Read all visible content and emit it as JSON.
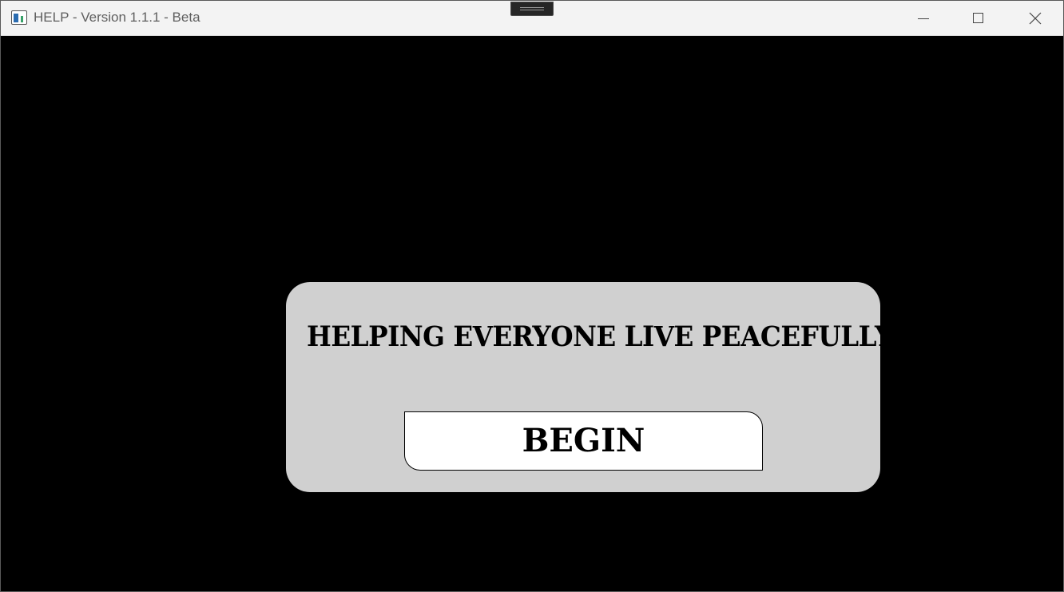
{
  "window": {
    "title": "HELP - Version 1.1.1 - Beta",
    "icon": "app-window-icon",
    "controls": {
      "minimize_icon": "minimize-icon",
      "maximize_icon": "maximize-icon",
      "close_icon": "close-icon"
    }
  },
  "main": {
    "headline": "HELPING EVERYONE LIVE PEACEFULLY",
    "begin_label": "BEGIN"
  },
  "colors": {
    "background": "#000000",
    "panel": "#d0d0d0",
    "button": "#ffffff",
    "titlebar": "#f3f3f3",
    "text": "#000000"
  }
}
